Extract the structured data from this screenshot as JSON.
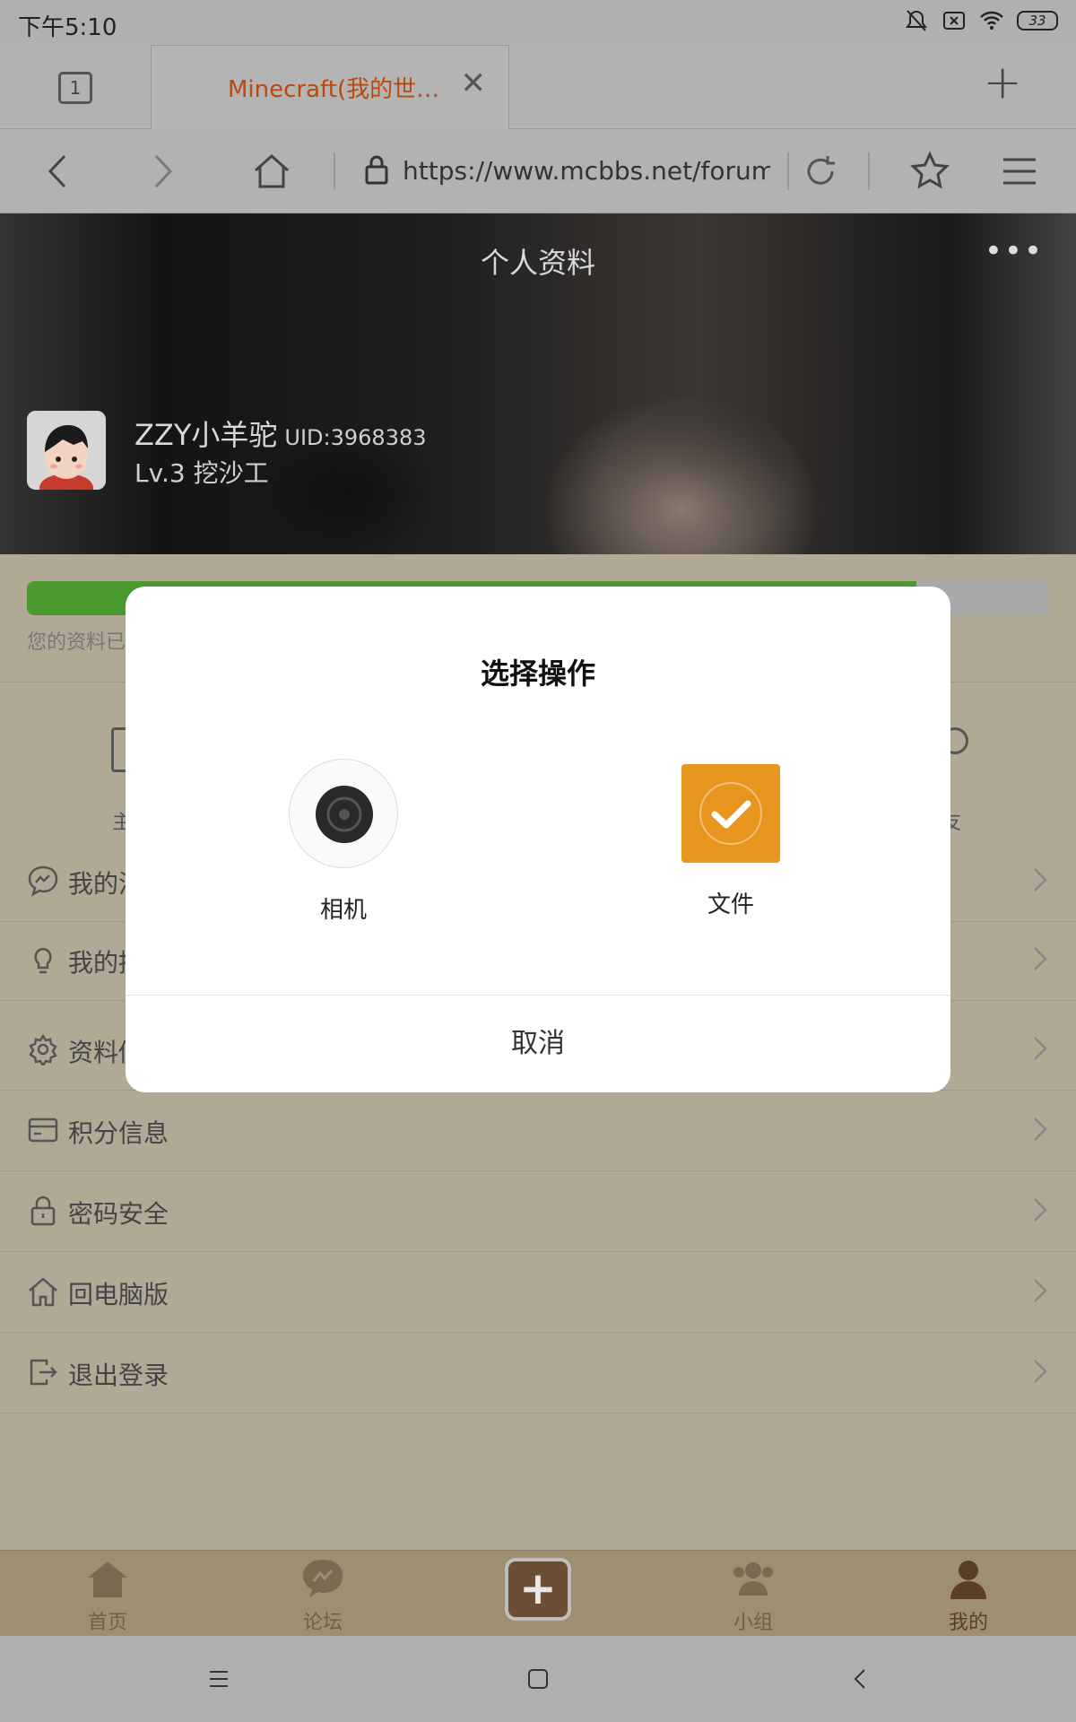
{
  "status_bar": {
    "time": "下午5:10",
    "battery": "33"
  },
  "browser": {
    "tab_count": "1",
    "tab_title": "Minecraft(我的世…",
    "url": "https://www.mcbbs.net/forum.ph"
  },
  "profile": {
    "page_title": "个人资料",
    "more": "•••",
    "username": "ZZY小羊驼",
    "uid": "UID:3968383",
    "level": "Lv.3 挖沙工",
    "progress_fraction": 0.87,
    "progress_note": "您的资料已"
  },
  "quick_actions": {
    "left_label": "主",
    "right_label": "友"
  },
  "menu": [
    {
      "label": "我的消",
      "icon": "message-icon"
    },
    {
      "label": "我的提",
      "icon": "bulb-icon"
    },
    {
      "label": "资料修",
      "icon": "gear-icon"
    },
    {
      "label": "积分信息",
      "icon": "card-icon"
    },
    {
      "label": "密码安全",
      "icon": "lock-icon"
    },
    {
      "label": "回电脑版",
      "icon": "home-icon"
    },
    {
      "label": "退出登录",
      "icon": "logout-icon"
    }
  ],
  "bottom_nav": [
    {
      "label": "首页",
      "icon": "home-icon"
    },
    {
      "label": "论坛",
      "icon": "forum-icon"
    },
    {
      "label": "小组",
      "icon": "group-icon"
    },
    {
      "label": "我的",
      "icon": "user-icon",
      "active": true
    }
  ],
  "dialog": {
    "title": "选择操作",
    "option_camera": "相机",
    "option_file": "文件",
    "cancel": "取消"
  },
  "colors": {
    "accent_orange": "#e8951f",
    "progress_green": "#4a9a30",
    "tab_title": "#b74a0c"
  }
}
